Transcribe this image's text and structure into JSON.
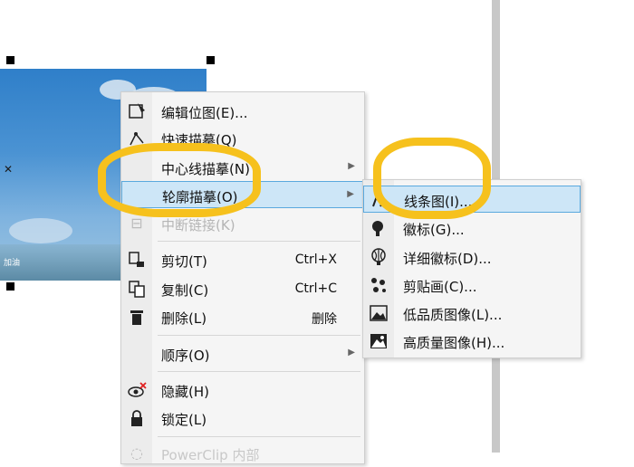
{
  "image": {
    "caption": "加油"
  },
  "context_menu": {
    "items": [
      {
        "label": "编辑位图(E)...",
        "icon": "edit-bitmap-icon"
      },
      {
        "label": "快速描摹(Q)",
        "icon": "quick-trace-icon"
      },
      {
        "label": "中心线描摹(N)",
        "icon": "",
        "submenu": true
      },
      {
        "label": "轮廓描摹(O)",
        "icon": "",
        "submenu": true,
        "highlighted": true
      },
      {
        "label": "中断链接(K)",
        "icon": "break-link-icon",
        "disabled": true
      },
      {
        "label": "剪切(T)",
        "shortcut": "Ctrl+X",
        "icon": "cut-icon"
      },
      {
        "label": "复制(C)",
        "shortcut": "Ctrl+C",
        "icon": "copy-icon"
      },
      {
        "label": "删除(L)",
        "shortcut": "删除",
        "icon": "delete-icon"
      },
      {
        "label": "顺序(O)",
        "icon": "",
        "submenu": true
      },
      {
        "label": "隐藏(H)",
        "icon": "hide-icon"
      },
      {
        "label": "锁定(L)",
        "icon": "lock-icon"
      },
      {
        "label": "PowerClip 内部",
        "icon": "powerclip-icon",
        "disabled": true
      }
    ]
  },
  "submenu": {
    "items": [
      {
        "label": "线条图(I)...",
        "icon": "line-art-icon",
        "highlighted": true
      },
      {
        "label": "徽标(G)...",
        "icon": "logo-icon"
      },
      {
        "label": "详细徽标(D)...",
        "icon": "detailed-logo-icon"
      },
      {
        "label": "剪贴画(C)...",
        "icon": "clipart-icon"
      },
      {
        "label": "低品质图像(L)...",
        "icon": "low-quality-image-icon"
      },
      {
        "label": "高质量图像(H)...",
        "icon": "high-quality-image-icon"
      }
    ]
  },
  "colors": {
    "highlight": "#cde6f7",
    "highlight_border": "#5aa9de",
    "annotation": "#f6c11d"
  }
}
